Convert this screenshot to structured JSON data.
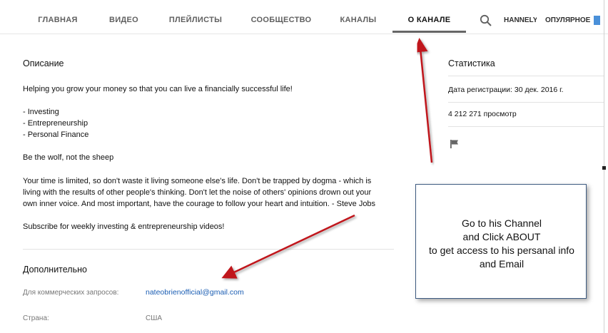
{
  "tabs": {
    "items": [
      "ГЛАВНАЯ",
      "ВИДЕО",
      "ПЛЕЙЛИСТЫ",
      "СООБЩЕСТВО",
      "КАНАЛЫ",
      "О КАНАЛЕ"
    ],
    "active": "О КАНАЛЕ",
    "overflow_left": "HANNELY",
    "overflow_right": "ОПУЛЯРНОЕ"
  },
  "description": {
    "title": "Описание",
    "lines": [
      "Helping you grow your money so that you can live a financially successful life!",
      "- Investing",
      "- Entrepreneurship",
      "- Personal Finance",
      "Be the wolf, not the sheep",
      "Your time is limited, so don't waste it living someone else's life. Don't be trapped by dogma - which is",
      "living with the results of other people's thinking. Don't let the noise of others' opinions drown out your",
      "own inner voice. And most important, have the courage to follow your heart and intuition. - Steve Jobs",
      "Subscribe for weekly investing & entrepreneurship videos!"
    ]
  },
  "details": {
    "title": "Дополнительно",
    "business_label": "Для коммерческих запросов:",
    "business_email": "nateobrienofficial@gmail.com",
    "country_label": "Страна:",
    "country_value": "США"
  },
  "stats": {
    "title": "Статистика",
    "joined": "Дата регистрации: 30 дек. 2016 г.",
    "views": "4 212 271 просмотр"
  },
  "callout": {
    "lines": [
      "Go to his Channel",
      "and Click ABOUT",
      "to get access to his persanal info",
      "and Email"
    ]
  },
  "colors": {
    "arrow": "#c0141a",
    "link": "#1a5db3",
    "callout_border": "#3d5a80"
  },
  "icons": [
    "search-icon",
    "flag-icon"
  ]
}
